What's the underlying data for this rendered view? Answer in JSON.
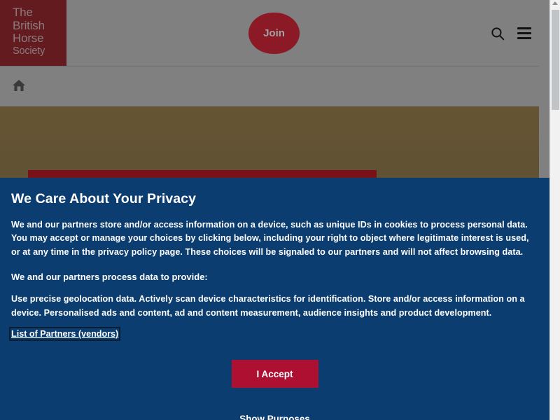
{
  "header": {
    "logo": {
      "name": "The British Horse Society",
      "lines": [
        "The",
        "British",
        "Horse",
        "Society"
      ]
    },
    "join_label": "Join",
    "search_icon": "search-icon",
    "menu_icon": "hamburger-menu-icon"
  },
  "breadcrumb": {
    "home_icon": "home-icon"
  },
  "hero": {
    "share_icon": "share-icon"
  },
  "privacy": {
    "title": "We Care About Your Privacy",
    "body": "We and our partners store and/or access information on a device, such as unique IDs in cookies to process personal data. You may accept or manage your choices by clicking below, including your right to object where legitimate interest is used, or at any time in the privacy policy page. These choices will be signaled to our partners and will not affect browsing data.",
    "subheading": "We and our partners process data to provide:",
    "purposes": "Use precise geolocation data. Actively scan device characteristics for identification. Store and/or access information on a device. Personalised ads and content, ad and content measurement, audience insights and product development.",
    "vendors_link": "List of Partners (vendors)",
    "accept_label": "I Accept",
    "show_purposes_label": "Show Purposes"
  },
  "colors": {
    "logo_bg": "#631b20",
    "join_bg": "#8b1a26",
    "modal_bg": "#0b3d70",
    "accept_bg": "#ad1030",
    "hero_bar": "#7a1118",
    "page_dim": "#808080"
  }
}
